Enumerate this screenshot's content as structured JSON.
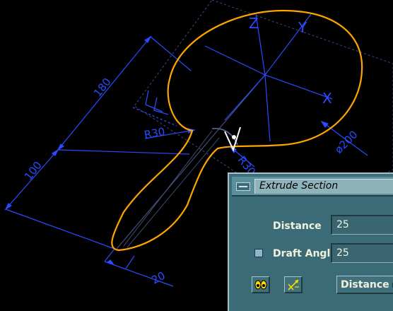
{
  "viewport": {
    "axis_labels": {
      "z": "Z",
      "y": "Y",
      "x": "X"
    },
    "dimensions": {
      "length_180": "180",
      "length_100": "100",
      "width_20": "20",
      "radius_r30_left": "R30",
      "radius_r30_right": "R30",
      "diameter_200": "ø200"
    },
    "colors": {
      "background": "#000000",
      "sketch_profile": "#ffa500",
      "dimension_lines": "#2a4bff",
      "construction_lines": "#4a5a9a"
    }
  },
  "dialog": {
    "title": "Extrude Section",
    "distance_label": "Distance",
    "distance_value": "25",
    "draft_angle_label": "Draft Angle",
    "draft_angle_value": "25",
    "draft_angle_checked": false,
    "mode_dropdown_value": "Distance",
    "icons": {
      "preview_button": "eyes-icon",
      "flip_button": "flip-direction-icon",
      "window_menu": "window-menu-icon"
    }
  }
}
